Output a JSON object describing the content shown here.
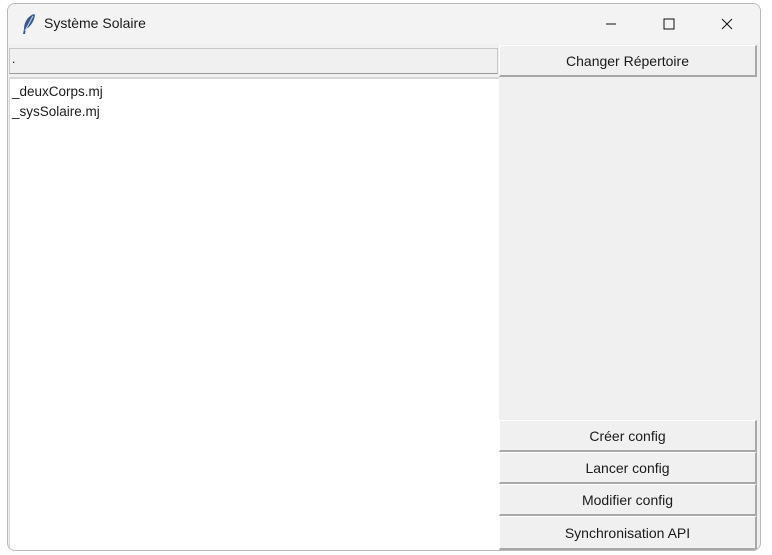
{
  "window": {
    "title": "Système Solaire"
  },
  "directory": {
    "value": "."
  },
  "files": [
    "_deuxCorps.mj",
    "_sysSolaire.mj"
  ],
  "buttons": {
    "change_dir": "Changer Répertoire",
    "create_config": "Créer config",
    "launch_config": "Lancer config",
    "modify_config": "Modifier config",
    "sync_api": "Synchronisation API"
  },
  "icons": {
    "app": "feather-icon",
    "minimize": "minimize-icon",
    "maximize": "maximize-icon",
    "close": "close-icon"
  }
}
